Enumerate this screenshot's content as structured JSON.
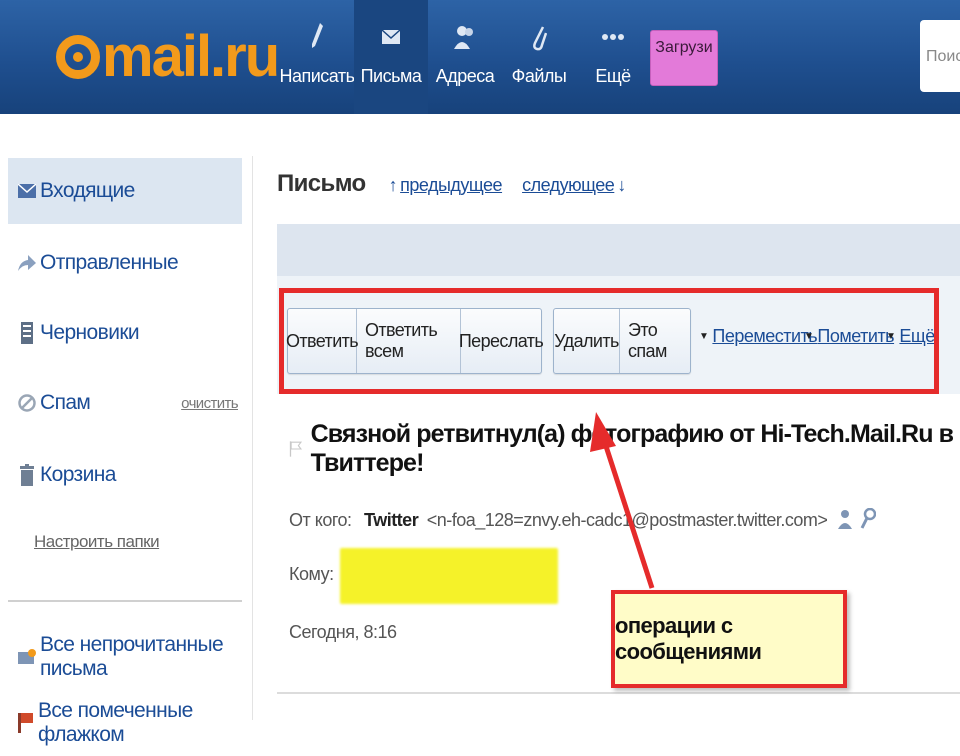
{
  "logo": {
    "text": "mail.ru"
  },
  "nav": [
    {
      "label": "Написать",
      "icon": "pencil-icon"
    },
    {
      "label": "Письма",
      "icon": "envelope-icon"
    },
    {
      "label": "Адреса",
      "icon": "contacts-icon"
    },
    {
      "label": "Файлы",
      "icon": "paperclip-icon"
    },
    {
      "label": "Ещё",
      "icon": "more-dots-icon"
    }
  ],
  "upload_button": "Загрузи",
  "search": {
    "placeholder": "Поиск"
  },
  "sidebar": {
    "folders": [
      {
        "label": "Входящие",
        "icon": "inbox-icon"
      },
      {
        "label": "Отправленные",
        "icon": "sent-icon"
      },
      {
        "label": "Черновики",
        "icon": "drafts-icon"
      },
      {
        "label": "Спам",
        "icon": "spam-icon",
        "action": "очистить"
      },
      {
        "label": "Корзина",
        "icon": "trash-icon"
      }
    ],
    "setup_link": "Настроить папки",
    "extra": [
      {
        "label": "Все непрочитанные письма",
        "icon": "unread-icon"
      },
      {
        "label": "Все помеченные флажком",
        "icon": "flagged-icon"
      }
    ]
  },
  "message_view": {
    "title": "Письмо",
    "prev_link": "предыдущее",
    "next_link": "следующее",
    "toolbar": {
      "group1": [
        "Ответить",
        "Ответить всем",
        "Переслать"
      ],
      "group2": [
        "Удалить",
        "Это спам"
      ],
      "dropdowns": [
        "Переместить",
        "Пометить",
        "Ещё"
      ]
    },
    "subject": "Связной ретвитнул(а) фотографию от Hi-Tech.Mail.Ru в Твиттере!",
    "from_label": "От кого:",
    "from_name": "Twitter",
    "from_email": "<n-foa_128=znvy.eh-cadc1@postmaster.twitter.com>",
    "to_label": "Кому:",
    "date": "Сегодня, 8:16"
  },
  "annotation": {
    "callout_text": "операции с сообщениями"
  },
  "colors": {
    "header_blue": "#1f4f8f",
    "logo_orange": "#f29a1b",
    "link_blue": "#1b4c96",
    "annotation_red": "#e52b2b",
    "callout_yellow": "#fffcc8",
    "upload_pink": "#e37ad9"
  }
}
